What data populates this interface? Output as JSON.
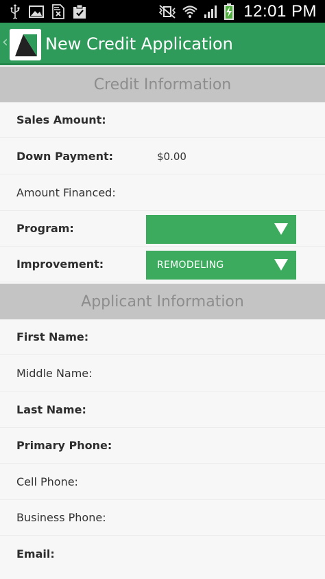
{
  "status_bar": {
    "time": "12:01 PM",
    "icons_left": [
      "usb-icon",
      "image-icon",
      "file-x-icon",
      "clipboard-icon"
    ],
    "icons_right": [
      "vibrate-mute-icon",
      "wifi-icon",
      "signal-icon",
      "battery-charging-icon"
    ]
  },
  "action_bar": {
    "title": "New Credit Application",
    "color": "#2e9b5a"
  },
  "credit_section": {
    "header": "Credit Information",
    "sales_amount_label": "Sales Amount:",
    "down_payment_label": "Down Payment:",
    "down_payment_value": "$0.00",
    "amount_financed_label": "Amount Financed:",
    "program_label": "Program:",
    "program_value": "",
    "improvement_label": "Improvement:",
    "improvement_value": "REMODELING"
  },
  "applicant_section": {
    "header": "Applicant Information",
    "first_name_label": "First Name:",
    "middle_name_label": "Middle Name:",
    "last_name_label": "Last Name:",
    "primary_phone_label": "Primary Phone:",
    "cell_phone_label": "Cell Phone:",
    "business_phone_label": "Business Phone:",
    "email_label": "Email:"
  },
  "colors": {
    "accent": "#2e9b5a",
    "spinner": "#3cab5e",
    "section_header_bg": "#c4c4c4",
    "section_header_text": "#8d8d8d"
  }
}
